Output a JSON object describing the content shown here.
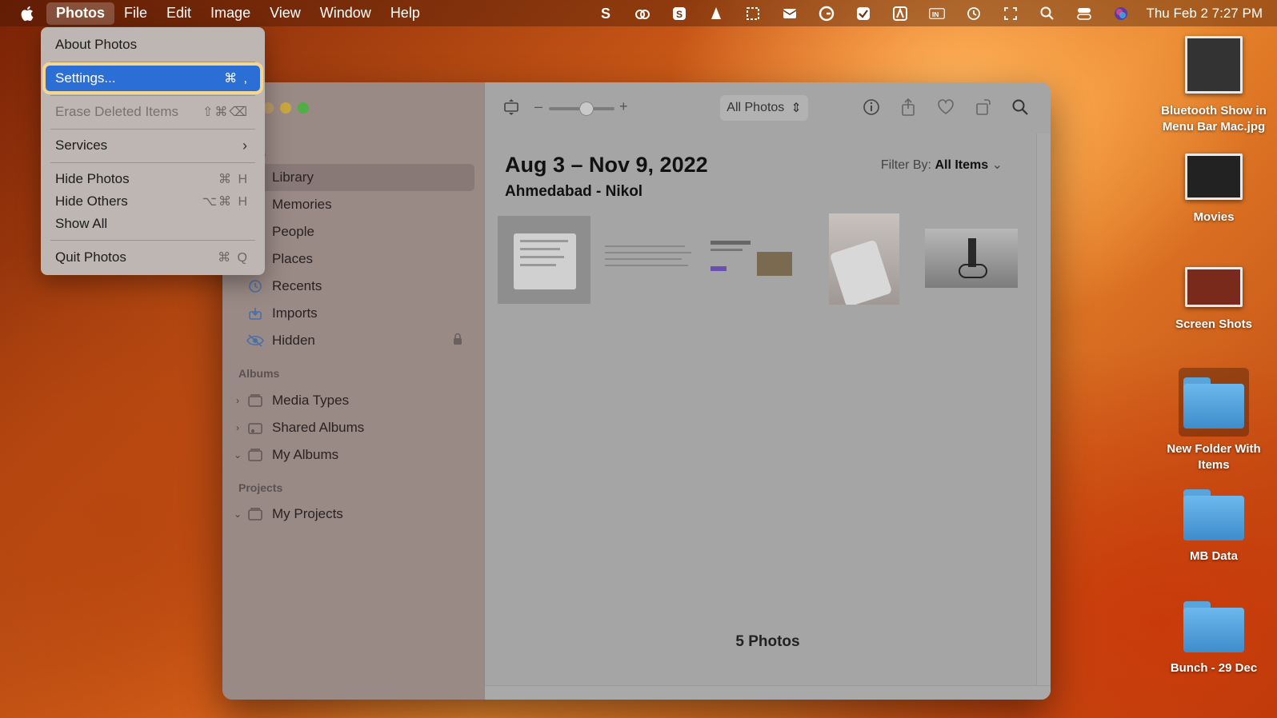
{
  "menubar": {
    "app_name": "Photos",
    "items": [
      "File",
      "Edit",
      "Image",
      "View",
      "Window",
      "Help"
    ],
    "clock": "Thu Feb 2  7:27 PM",
    "status_icons": [
      "scrivener-icon",
      "creative-cloud-icon",
      "skype-icon",
      "vlc-icon",
      "screenshot-icon",
      "mail-icon",
      "grammarly-icon",
      "tick-icon",
      "autocad-icon",
      "input-icon",
      "time-machine-icon",
      "expand-icon",
      "spotlight-icon",
      "control-center-icon",
      "siri-icon"
    ]
  },
  "dropdown": {
    "items": [
      {
        "label": "About Photos",
        "shortcut": ""
      },
      {
        "label": "Settings...",
        "shortcut": "⌘ ,"
      },
      {
        "label": "Erase Deleted Items",
        "shortcut": "⇧⌘⌫"
      },
      {
        "label": "Services",
        "shortcut": ""
      },
      {
        "label": "Hide Photos",
        "shortcut": "⌘ H"
      },
      {
        "label": "Hide Others",
        "shortcut": "⌥⌘ H"
      },
      {
        "label": "Show All",
        "shortcut": ""
      },
      {
        "label": "Quit Photos",
        "shortcut": "⌘ Q"
      }
    ]
  },
  "sidebar": {
    "photos_header": "os",
    "photos_items": [
      "Library",
      "Memories",
      "People",
      "Places",
      "Recents",
      "Imports",
      "Hidden"
    ],
    "albums_header": "Albums",
    "albums_items": [
      "Media Types",
      "Shared Albums",
      "My Albums"
    ],
    "projects_header": "Projects",
    "projects_items": [
      "My Projects"
    ]
  },
  "main": {
    "view_select": "All Photos",
    "date_range": "Aug 3 – Nov 9, 2022",
    "location": "Ahmedabad - Nikol",
    "filter_label": "Filter By:",
    "filter_value": "All Items",
    "photo_count": "5 Photos"
  },
  "desktop": {
    "items": [
      {
        "label": "Bluetooth Show in Menu Bar Mac.jpg"
      },
      {
        "label": "Movies"
      },
      {
        "label": "Screen Shots"
      },
      {
        "label": "New Folder With Items"
      },
      {
        "label": "MB Data"
      },
      {
        "label": "Bunch - 29 Dec"
      }
    ]
  }
}
